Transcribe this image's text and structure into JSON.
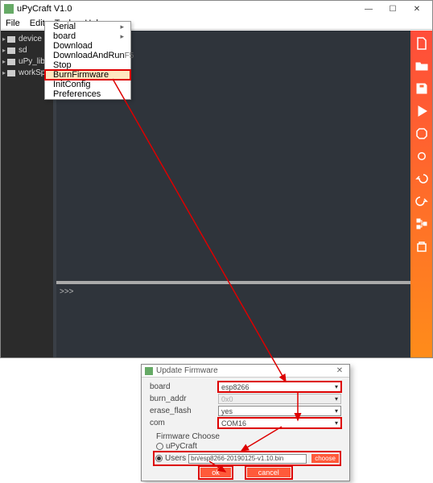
{
  "main_window": {
    "title": "uPyCraft V1.0",
    "win_controls": {
      "min": "—",
      "max": "☐",
      "close": "✕"
    }
  },
  "menubar": {
    "items": [
      "File",
      "Edit",
      "Tools",
      "Help"
    ]
  },
  "tools_menu": {
    "items": [
      {
        "label": "Serial",
        "sub": true
      },
      {
        "label": "board",
        "sub": true
      },
      {
        "label": "Download"
      },
      {
        "label": "DownloadAndRun",
        "shortcut": "F5"
      },
      {
        "label": "Stop"
      },
      {
        "label": "BurnFirmware",
        "highlight": true
      },
      {
        "label": "InitConfig"
      },
      {
        "label": "Preferences"
      }
    ]
  },
  "tree": {
    "items": [
      "device",
      "sd",
      "uPy_lib",
      "workSpa"
    ]
  },
  "console": {
    "prompt": ">>>"
  },
  "sidebar_icons": [
    "new-file-icon",
    "open-file-icon",
    "save-icon",
    "run-icon",
    "stop-icon",
    "connect-icon",
    "undo-icon",
    "redo-icon",
    "tree-view-icon",
    "clear-icon"
  ],
  "dialog": {
    "title": "Update Firmware",
    "fields": {
      "board": {
        "label": "board",
        "value": "esp8266"
      },
      "burn_addr": {
        "label": "burn_addr",
        "value": "0x0"
      },
      "erase_flash": {
        "label": "erase_flash",
        "value": "yes"
      },
      "com": {
        "label": "com",
        "value": "COM16"
      }
    },
    "firmware_choose_label": "Firmware Choose",
    "radio_upycraft": "uPyCraft",
    "radio_users": "Users",
    "user_path": "bn/esp8266-20190125-v1.10.bin",
    "choose_label": "choose",
    "ok_label": "ok",
    "cancel_label": "cancel"
  }
}
